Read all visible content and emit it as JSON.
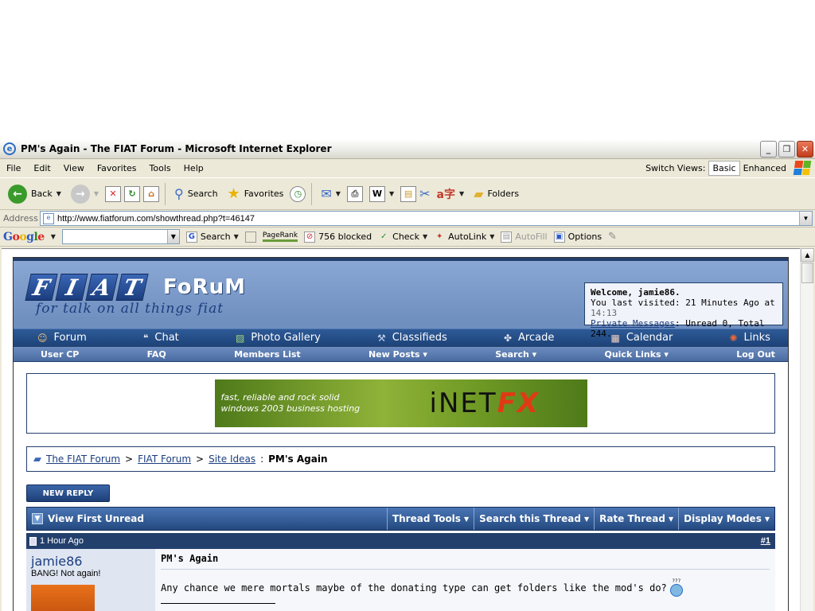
{
  "window": {
    "title": "PM's Again - The FIAT Forum - Microsoft Internet Explorer"
  },
  "menu": [
    "File",
    "Edit",
    "View",
    "Favorites",
    "Tools",
    "Help"
  ],
  "switch_views": {
    "label": "Switch Views:",
    "basic": "Basic",
    "enhanced": "Enhanced"
  },
  "toolbar": {
    "back": "Back",
    "search": "Search",
    "favorites": "Favorites",
    "folders": "Folders"
  },
  "address": {
    "label": "Address",
    "url": "http://www.fiatforum.com/showthread.php?t=46147"
  },
  "google_bar": {
    "logo": "Google",
    "search": "Search",
    "pagerank": "PageRank",
    "blocked": "756 blocked",
    "check": "Check",
    "autolink": "AutoLink",
    "autofill": "AutoFill",
    "options": "Options"
  },
  "site": {
    "logo_letters": [
      "F",
      "I",
      "A",
      "T"
    ],
    "logo_forum": "FoRuM",
    "logo_tagline": "for talk on all things fiat",
    "welcome": {
      "line1": "Welcome, jamie86.",
      "last_visited": "You last visited: 21 Minutes Ago at",
      "time": "14:13",
      "pm_link": "Private Messages",
      "pm_status": ": Unread 0, Total 244."
    },
    "nav_main": [
      "Forum",
      "Chat",
      "Photo Gallery",
      "Classifieds",
      "Arcade",
      "Calendar",
      "Links"
    ],
    "nav_sub": [
      "User CP",
      "FAQ",
      "Members List",
      "New Posts ▾",
      "Search ▾",
      "Quick Links ▾",
      "Log Out"
    ],
    "banner": {
      "text1": "fast, reliable and rock solid",
      "text2": "windows 2003 business hosting",
      "brand": "iNET",
      "brand_accent": "FX"
    },
    "breadcrumb": {
      "home": "The FIAT Forum",
      "sep": ">",
      "forum": "FIAT Forum",
      "section": "Site Ideas",
      "colon": ":",
      "current": "PM's Again"
    },
    "new_reply": "NEW REPLY",
    "thread_bar": {
      "first_unread": "View First Unread",
      "tools": [
        "Thread Tools",
        "Search this Thread",
        "Rate Thread",
        "Display Modes"
      ]
    },
    "post": {
      "time": "1 Hour Ago",
      "number": "#1",
      "username": "jamie86",
      "user_title": "BANG! Not again!",
      "title": "PM's Again",
      "message": "Any chance we mere mortals maybe of the donating type can get folders like the mod's do?",
      "smiley_caption": "???"
    }
  }
}
